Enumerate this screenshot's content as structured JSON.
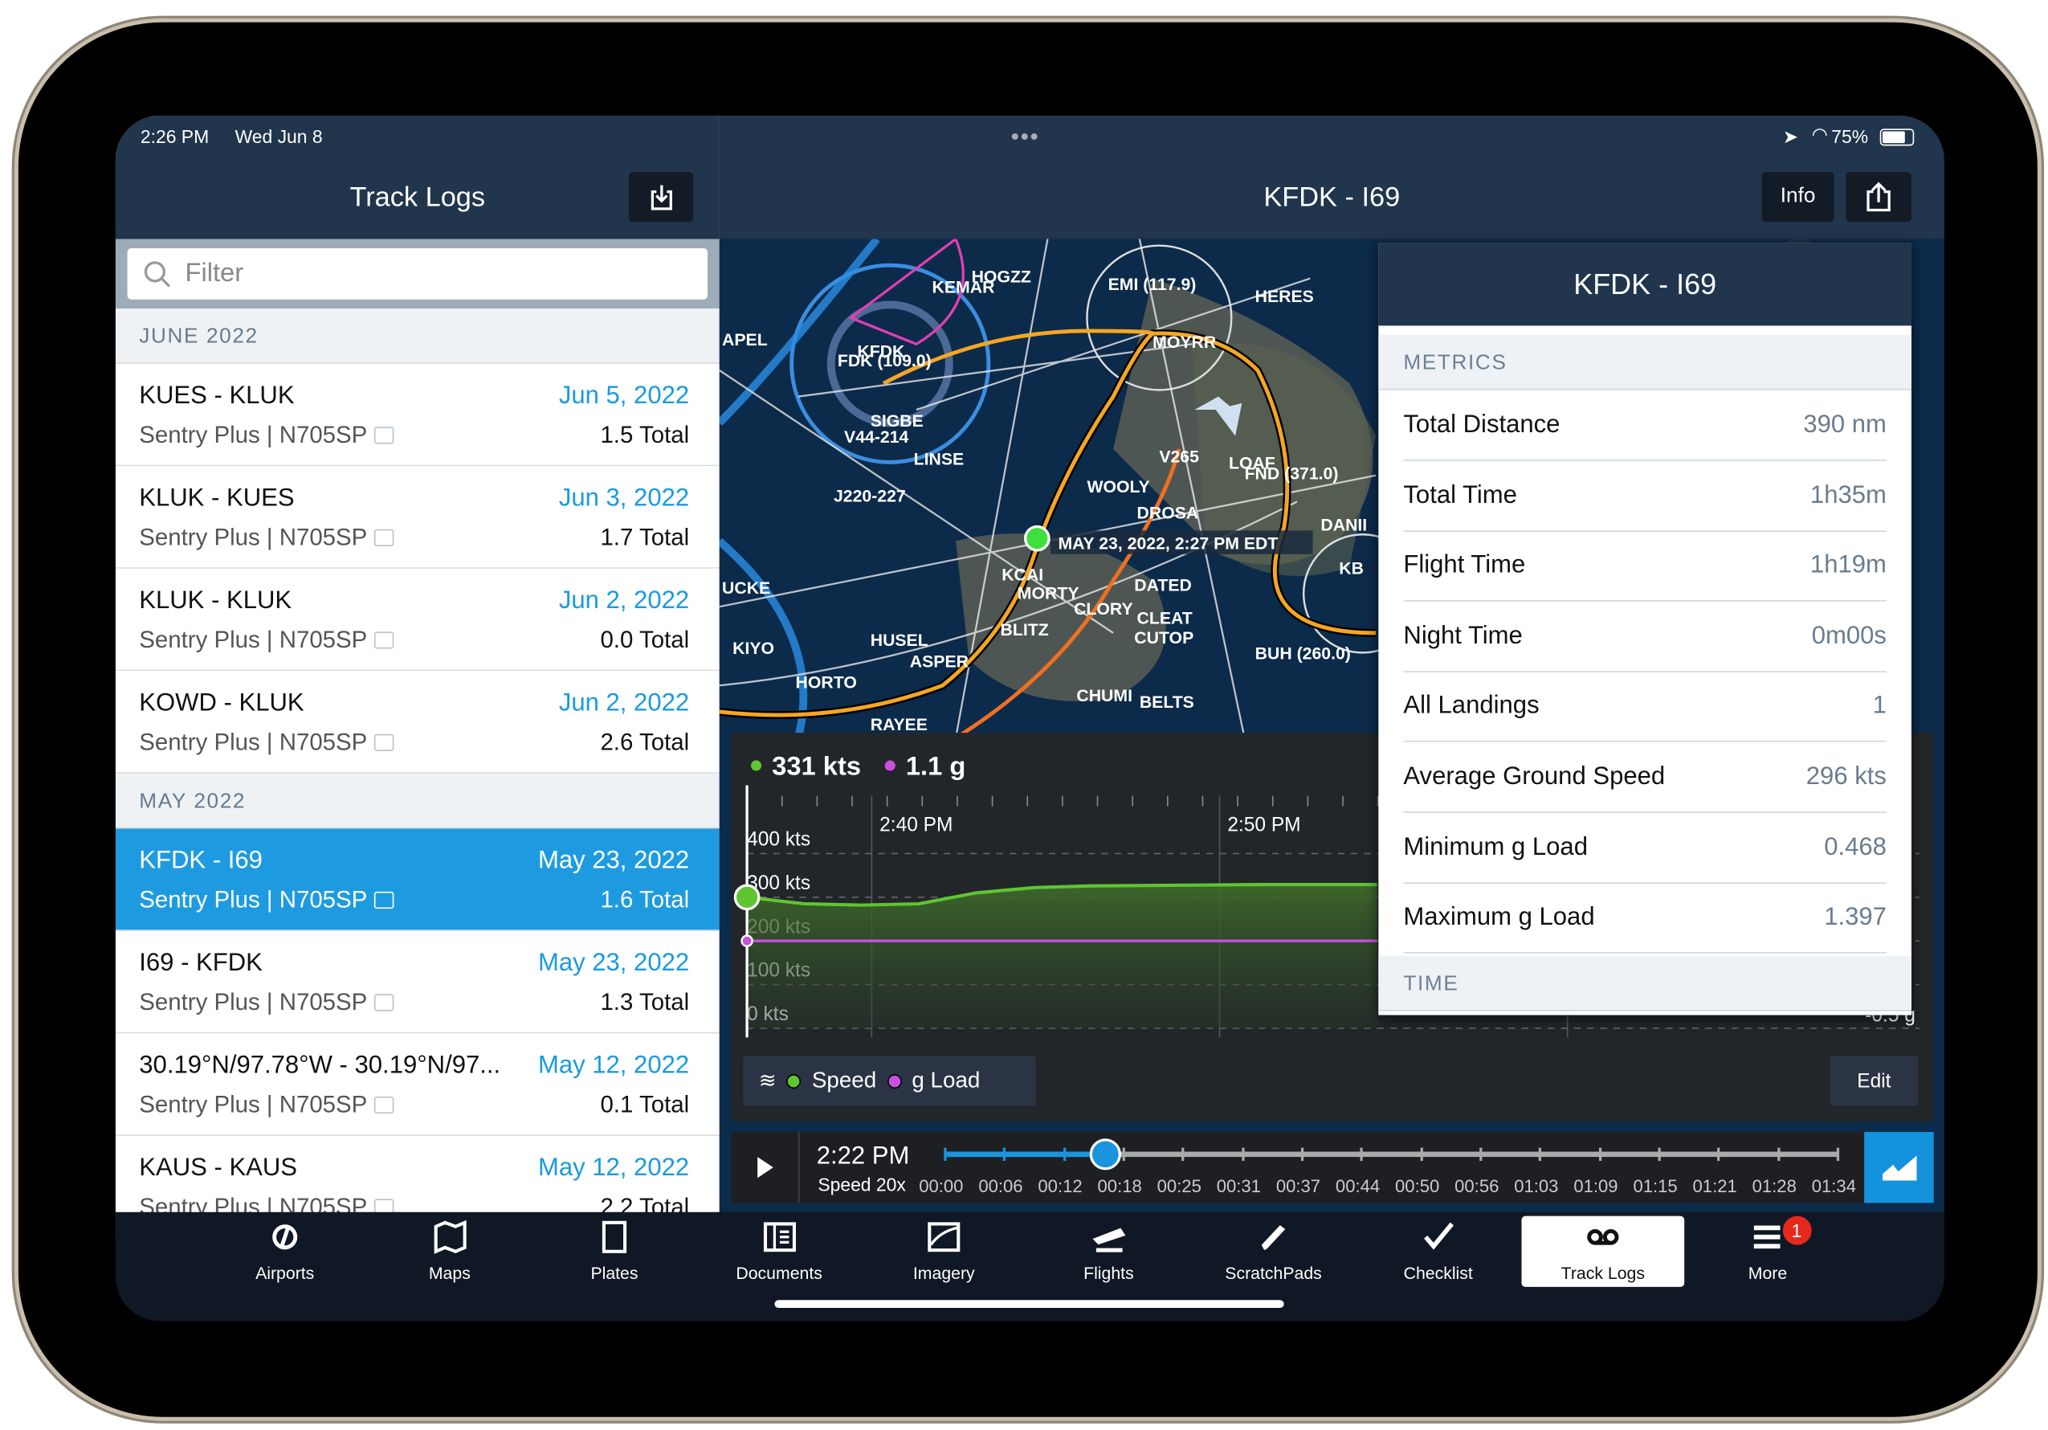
{
  "status": {
    "time": "2:26 PM",
    "date": "Wed Jun 8",
    "battery": "75%"
  },
  "left_panel": {
    "title": "Track Logs",
    "filter_placeholder": "Filter",
    "sections": [
      {
        "label": "JUNE 2022",
        "items": [
          {
            "route": "KUES - KLUK",
            "date": "Jun 5, 2022",
            "device": "Sentry Plus | N705SP",
            "total": "1.5 Total"
          },
          {
            "route": "KLUK - KUES",
            "date": "Jun 3, 2022",
            "device": "Sentry Plus | N705SP",
            "total": "1.7 Total"
          },
          {
            "route": "KLUK - KLUK",
            "date": "Jun 2, 2022",
            "device": "Sentry Plus | N705SP",
            "total": "0.0 Total"
          },
          {
            "route": "KOWD - KLUK",
            "date": "Jun 2, 2022",
            "device": "Sentry Plus | N705SP",
            "total": "2.6 Total"
          }
        ]
      },
      {
        "label": "MAY 2022",
        "items": [
          {
            "route": "KFDK - I69",
            "date": "May 23, 2022",
            "device": "Sentry Plus | N705SP",
            "total": "1.6 Total",
            "selected": true
          },
          {
            "route": "I69 - KFDK",
            "date": "May 23, 2022",
            "device": "Sentry Plus | N705SP",
            "total": "1.3 Total"
          },
          {
            "route": "30.19°N/97.78°W - 30.19°N/97...",
            "date": "May 12, 2022",
            "device": "Sentry Plus | N705SP",
            "total": "0.1 Total"
          },
          {
            "route": "KAUS - KAUS",
            "date": "May 12, 2022",
            "device": "Sentry Plus | N705SP",
            "total": "2.2 Total"
          }
        ]
      }
    ]
  },
  "right_panel": {
    "title": "KFDK - I69",
    "info_label": "Info"
  },
  "map": {
    "labels": [
      "KFDK",
      "FDK (109.0)",
      "HOGZZ",
      "KEMAR",
      "EMI (117.9)",
      "HERES",
      "MOYRR",
      "SIGBE",
      "LINSE",
      "V44-214",
      "J220-227",
      "V265",
      "WOOLY",
      "DROSA",
      "LOAF",
      "FND (371.0)",
      "DANII",
      "KCAI",
      "MORTY",
      "CLORY",
      "DATED",
      "CLEAT",
      "CUTOP",
      "BLITZ",
      "HUSEL",
      "ASPER",
      "KIYO",
      "HORTO",
      "RAYEE",
      "CHUMI",
      "BELTS",
      "BUH (260.0)",
      "APEL",
      "UCKE",
      "KB"
    ],
    "marker_label": "MAY 23, 2022, 2:27 PM EDT"
  },
  "chart": {
    "speed_readout": "331 kts",
    "g_readout": "1.1 g",
    "x_ticks": [
      "2:40 PM",
      "2:50 PM"
    ],
    "y_ticks": [
      "400 kts",
      "300 kts",
      "200 kts",
      "100 kts",
      "0 kts"
    ],
    "right_tick": "-0.5 g",
    "legend": [
      "Speed",
      "g Load"
    ],
    "edit_label": "Edit",
    "colors": {
      "speed": "#5fc531",
      "g_load": "#c84fe0"
    }
  },
  "chart_data": {
    "type": "line",
    "x_ticks": [
      "2:40 PM",
      "2:50 PM"
    ],
    "ylim": [
      0,
      400
    ],
    "series": [
      {
        "name": "Speed",
        "values": [
          300,
          285,
          282,
          285,
          310,
          322,
          326,
          327,
          328,
          329,
          329,
          329
        ]
      },
      {
        "name": "g Load",
        "values": [
          1.0,
          1.0,
          1.0,
          1.0,
          1.0,
          1.0,
          1.0,
          1.0,
          1.0,
          1.0,
          1.0,
          1.0
        ]
      }
    ]
  },
  "playback": {
    "time": "2:22 PM",
    "speed": "Speed 20x",
    "ticks": [
      "00:00",
      "00:06",
      "00:12",
      "00:18",
      "00:25",
      "00:31",
      "00:37",
      "00:44",
      "00:50",
      "00:56",
      "01:03",
      "01:09",
      "01:15",
      "01:21",
      "01:28",
      "01:34"
    ],
    "progress": 0.18
  },
  "info": {
    "title": "KFDK - I69",
    "metrics_label": "METRICS",
    "time_label": "TIME",
    "metrics": [
      {
        "label": "Total Distance",
        "value": "390 nm"
      },
      {
        "label": "Total Time",
        "value": "1h35m"
      },
      {
        "label": "Flight Time",
        "value": "1h19m"
      },
      {
        "label": "Night Time",
        "value": "0m00s"
      },
      {
        "label": "All Landings",
        "value": "1"
      },
      {
        "label": "Average Ground Speed",
        "value": "296 kts"
      },
      {
        "label": "Minimum g Load",
        "value": "0.468"
      },
      {
        "label": "Maximum g Load",
        "value": "1.397"
      }
    ]
  },
  "tabs": [
    {
      "label": "Airports",
      "icon": "airport-icon"
    },
    {
      "label": "Maps",
      "icon": "map-icon"
    },
    {
      "label": "Plates",
      "icon": "plate-icon"
    },
    {
      "label": "Documents",
      "icon": "document-icon"
    },
    {
      "label": "Imagery",
      "icon": "imagery-icon"
    },
    {
      "label": "Flights",
      "icon": "plane-icon"
    },
    {
      "label": "ScratchPads",
      "icon": "pencil-icon"
    },
    {
      "label": "Checklist",
      "icon": "check-icon"
    },
    {
      "label": "Track Logs",
      "icon": "track-icon",
      "selected": true
    },
    {
      "label": "More",
      "icon": "menu-icon",
      "badge": "1"
    }
  ]
}
